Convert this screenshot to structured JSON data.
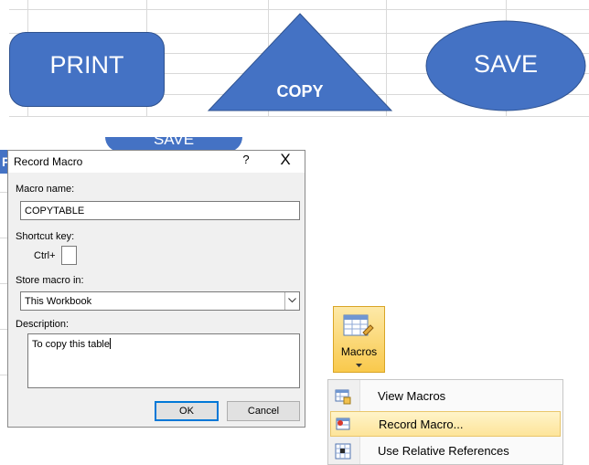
{
  "shapes": {
    "print_label": "PRINT",
    "copy_label": "COPY",
    "save_label": "SAVE",
    "fill_color": "#4472c4"
  },
  "behind_dialog": {
    "partial_save": "SAVE",
    "partial_print": "P"
  },
  "dialog": {
    "title": "Record Macro",
    "help_label": "?",
    "close_label": "X",
    "macro_name_label": "Macro name:",
    "macro_name_value": "COPYTABLE",
    "shortcut_key_label": "Shortcut key:",
    "ctrl_label": "Ctrl+",
    "shortcut_value": "",
    "store_in_label": "Store macro in:",
    "store_in_value": "This Workbook",
    "description_label": "Description:",
    "description_value": "To copy this table",
    "ok_label": "OK",
    "cancel_label": "Cancel"
  },
  "ribbon": {
    "macros_label": "Macros",
    "menu_items": [
      {
        "label": "View Macros",
        "icon": "view-macros-icon"
      },
      {
        "label": "Record Macro...",
        "icon": "record-macro-icon",
        "highlighted": true
      },
      {
        "label": "Use Relative References",
        "icon": "relative-references-icon"
      }
    ],
    "highlight_color": "#fde49a"
  }
}
